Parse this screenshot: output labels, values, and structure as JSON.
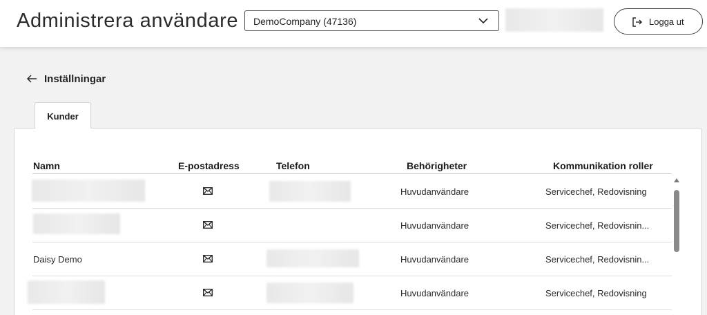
{
  "header": {
    "title": "Administrera användare",
    "company_select": {
      "value": "DemoCompany (47136)"
    },
    "logout_label": "Logga ut"
  },
  "nav": {
    "back_label": "Inställningar"
  },
  "tabs": [
    {
      "label": "Kunder",
      "active": true
    }
  ],
  "table": {
    "columns": [
      "Namn",
      "E-postadress",
      "Telefon",
      "Behörigheter",
      "Kommunikation roller"
    ],
    "rows": [
      {
        "name": "",
        "permissions": "Huvudanvändare",
        "roles": "Servicechef, Redovisning"
      },
      {
        "name": "",
        "permissions": "Huvudanvändare",
        "roles": "Servicechef, Redovisnin..."
      },
      {
        "name": "Daisy Demo",
        "permissions": "Huvudanvändare",
        "roles": "Servicechef, Redovisnin..."
      },
      {
        "name": "",
        "permissions": "Huvudanvändare",
        "roles": "Servicechef, Redovisning"
      }
    ]
  },
  "icons": {
    "email": "mail-icon",
    "back": "arrow-left-icon",
    "logout": "logout-icon",
    "dropdown": "chevron-down-icon"
  }
}
